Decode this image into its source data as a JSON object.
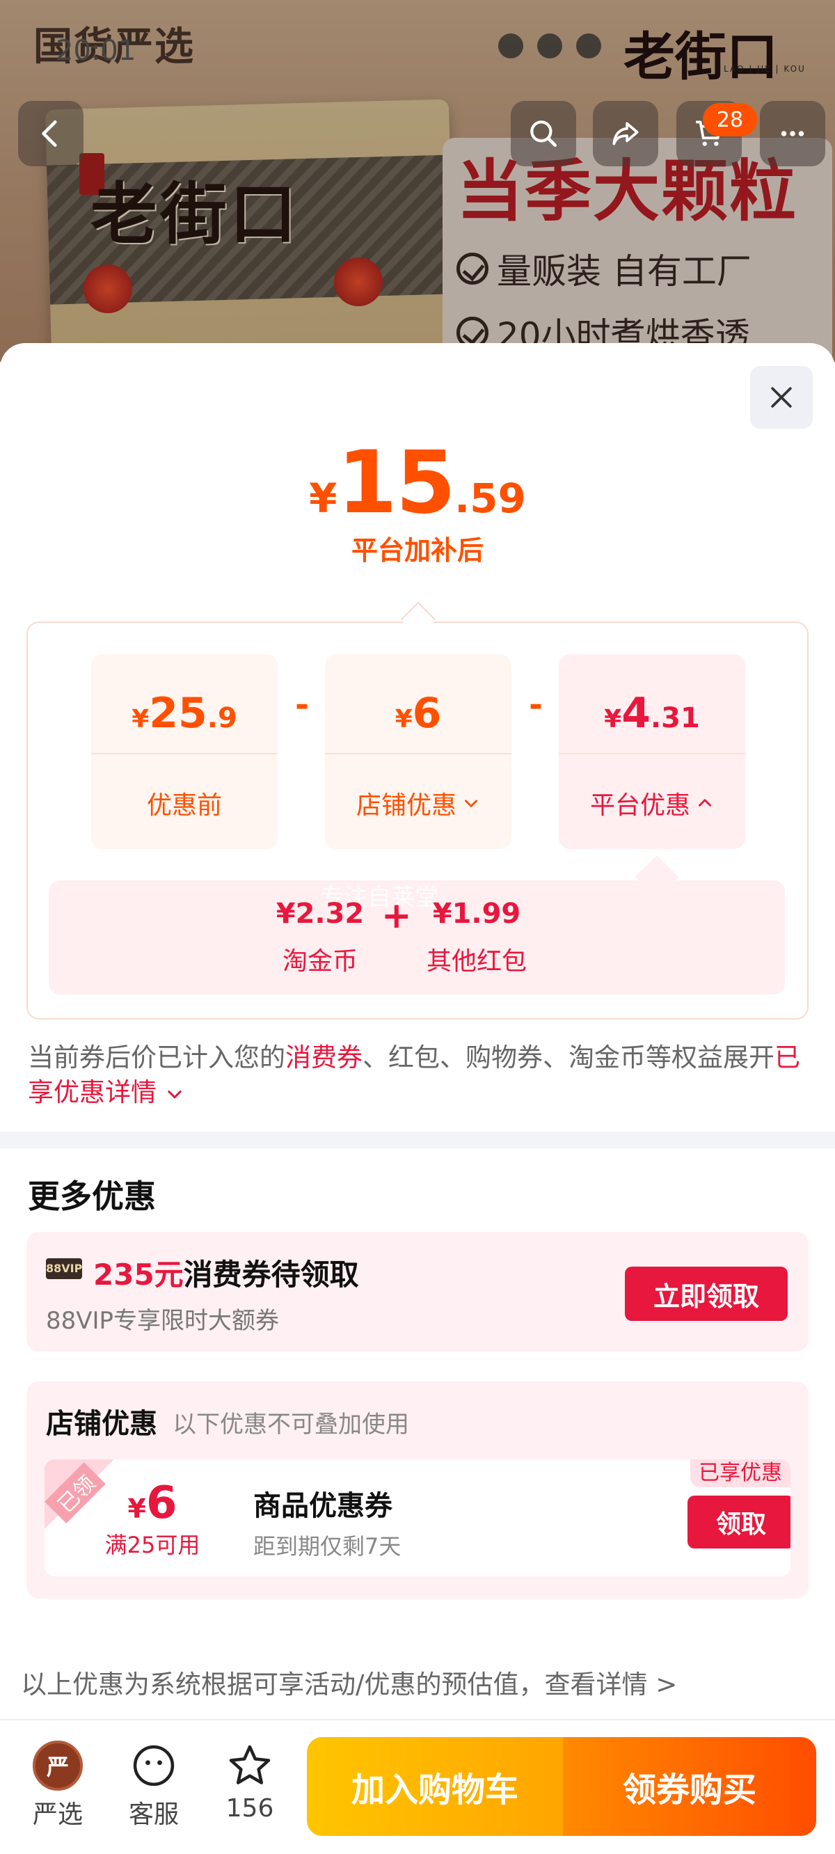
{
  "status_bar": {
    "time": "20:01"
  },
  "header": {
    "brand_left": "国货严选",
    "brand_right": "老街口",
    "brand_right_sub": "LAO | JIE | KOU",
    "cart_count": "28"
  },
  "product_image": {
    "logo_text": "老街口",
    "promo_title": "当季大颗粒",
    "promo_lines": [
      "量贩装 自有工厂",
      "20小时煮烘香透"
    ]
  },
  "price": {
    "symbol": "¥",
    "integer": "15",
    "decimal": ".59",
    "caption": "平台加补后"
  },
  "breakdown": {
    "minus": "-",
    "items": [
      {
        "symbol": "¥",
        "integer": "25",
        "decimal": ".9",
        "label": "优惠前"
      },
      {
        "symbol": "¥",
        "integer": "6",
        "decimal": "",
        "label": "店铺优惠"
      },
      {
        "symbol": "¥",
        "integer": "4",
        "decimal": ".31",
        "label": "平台优惠"
      }
    ],
    "platform_detail": {
      "plus": "+",
      "watermark": "专注自莱堂",
      "items": [
        {
          "amount": "¥2.32",
          "name": "淘金币"
        },
        {
          "amount": "¥1.99",
          "name": "其他红包"
        }
      ]
    }
  },
  "note": {
    "part1": "当前券后价已计入您的",
    "highlight1": "消费券",
    "part2": "、红包、购物券、淘金币等权益展开",
    "highlight2": "已享优惠详情"
  },
  "more_offers": {
    "title": "更多优惠",
    "vip_card": {
      "badge": "88VIP",
      "amount": "235元",
      "title": "消费券待领取",
      "subtitle": "88VIP专享限时大额券",
      "button": "立即领取"
    },
    "shop_card": {
      "title": "店铺优惠",
      "subtitle": "以下优惠不可叠加使用",
      "coupon": {
        "ribbon": "已领",
        "symbol": "¥",
        "amount": "6",
        "condition": "满25可用",
        "name": "商品优惠券",
        "expiry": "距到期仅剩7天",
        "tag": "已享优惠",
        "button": "领取"
      }
    }
  },
  "disclaimer": "以上优惠为系统根据可享活动/优惠的预估值，查看详情 >",
  "toolbar": {
    "items": [
      {
        "label": "严选",
        "icon_char": "严"
      },
      {
        "label": "客服"
      },
      {
        "label": "156"
      }
    ],
    "add_to_cart": "加入购物车",
    "buy": "领券购买"
  },
  "colors": {
    "orange": "#ff5000",
    "red": "#e8173d",
    "yellow": "#ffc500"
  }
}
